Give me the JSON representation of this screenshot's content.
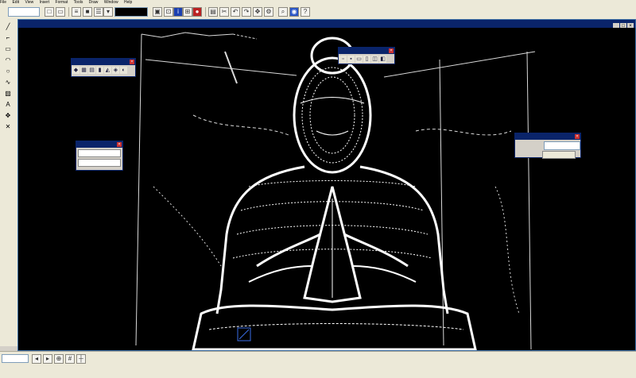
{
  "app": {
    "menu_items": [
      "File",
      "Edit",
      "View",
      "Insert",
      "Format",
      "Tools",
      "Draw",
      "Window",
      "Help"
    ]
  },
  "toolbar": {
    "layer_value": "",
    "color_value": "",
    "icons": [
      "new-icon",
      "open-icon",
      "save-icon",
      "print-icon",
      "cut-icon",
      "copy-icon",
      "paste-icon",
      "undo-icon",
      "redo-icon",
      "layer-icon",
      "color-icon",
      "linetype-icon",
      "info-icon",
      "zoom-icon",
      "pan-icon",
      "help-icon"
    ]
  },
  "document": {
    "title": ""
  },
  "palettes": {
    "left_toolbar": {
      "title": ""
    },
    "top_toolbar": {
      "title": ""
    },
    "properties": {
      "title": "",
      "rows": [
        "",
        "",
        ""
      ]
    },
    "dialog": {
      "title": "",
      "field_label": "",
      "field_value": "",
      "button_label": ""
    }
  },
  "statusbar": {
    "command_value": "",
    "status_text": ""
  },
  "colors": {
    "background": "#000000",
    "model": "#ffffff",
    "titlebar": "#0a246a",
    "chrome": "#ece9d8"
  }
}
